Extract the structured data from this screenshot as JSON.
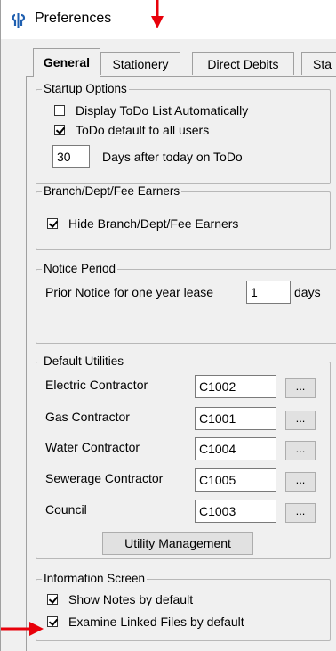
{
  "window": {
    "title": "Preferences",
    "accent_color": "#e8000a"
  },
  "tabs": [
    {
      "label": "General",
      "active": true
    },
    {
      "label": "Stationery",
      "active": false
    },
    {
      "label": "Direct Debits",
      "active": false
    },
    {
      "label": "Sta",
      "active": false
    }
  ],
  "startup": {
    "legend": "Startup Options",
    "display_todo": {
      "label": "Display ToDo List Automatically",
      "checked": false
    },
    "todo_default": {
      "label": "ToDo default to all users",
      "checked": true
    },
    "days_value": "30",
    "days_label": "Days after today on ToDo"
  },
  "branch": {
    "legend": "Branch/Dept/Fee Earners",
    "hide": {
      "label": "Hide Branch/Dept/Fee Earners",
      "checked": true
    }
  },
  "notice": {
    "legend": "Notice Period",
    "label": "Prior Notice for one year lease",
    "value": "1",
    "unit": "days"
  },
  "utilities": {
    "legend": "Default Utilities",
    "rows": [
      {
        "label": "Electric Contractor",
        "value": "C1002",
        "button": "..."
      },
      {
        "label": "Gas Contractor",
        "value": "C1001",
        "button": "..."
      },
      {
        "label": "Water Contractor",
        "value": "C1004",
        "button": "..."
      },
      {
        "label": "Sewerage Contractor",
        "value": "C1005",
        "button": "..."
      },
      {
        "label": "Council",
        "value": "C1003",
        "button": "..."
      }
    ],
    "manage_button": "Utility Management"
  },
  "info": {
    "legend": "Information Screen",
    "show_notes": {
      "label": "Show Notes by default",
      "checked": true
    },
    "examine_linked": {
      "label": "Examine Linked Files by default",
      "checked": true
    }
  },
  "annotations": {
    "arrow_icon": "red-arrow-icon"
  }
}
